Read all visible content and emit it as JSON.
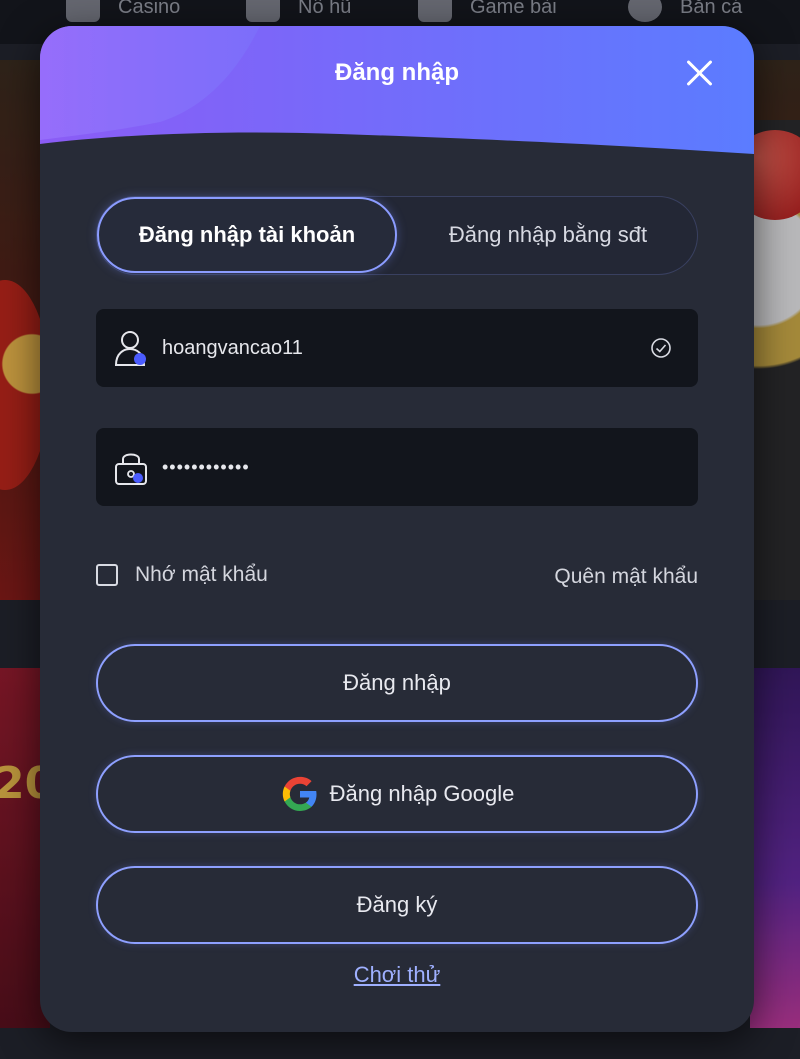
{
  "nav": {
    "items": [
      {
        "label": "Casino",
        "icon": "play-icon"
      },
      {
        "label": "Nổ hũ",
        "icon": "slot-icon"
      },
      {
        "label": "Game bài",
        "icon": "cards-icon"
      },
      {
        "label": "Bắn cá",
        "icon": "fish-icon"
      }
    ]
  },
  "modal": {
    "title": "Đăng nhập",
    "tabs": [
      {
        "label": "Đăng nhập tài khoản",
        "active": true
      },
      {
        "label": "Đăng nhập bằng sđt",
        "active": false
      }
    ],
    "username": {
      "value": "hoangvancao11",
      "icon": "user-icon"
    },
    "password": {
      "value": "••••••••••••",
      "icon": "lock-icon"
    },
    "remember_label": "Nhớ mật khẩu",
    "forgot_label": "Quên mật khẩu",
    "login_button": "Đăng nhập",
    "google_button": "Đăng nhập Google",
    "register_button": "Đăng ký",
    "try_link": "Chơi thử"
  },
  "colors": {
    "accent": "#8ea0ff",
    "header_gradient_start": "#8b5cf6",
    "header_gradient_end": "#5b7cff",
    "modal_bg": "#272b37",
    "input_bg": "#12151c"
  }
}
